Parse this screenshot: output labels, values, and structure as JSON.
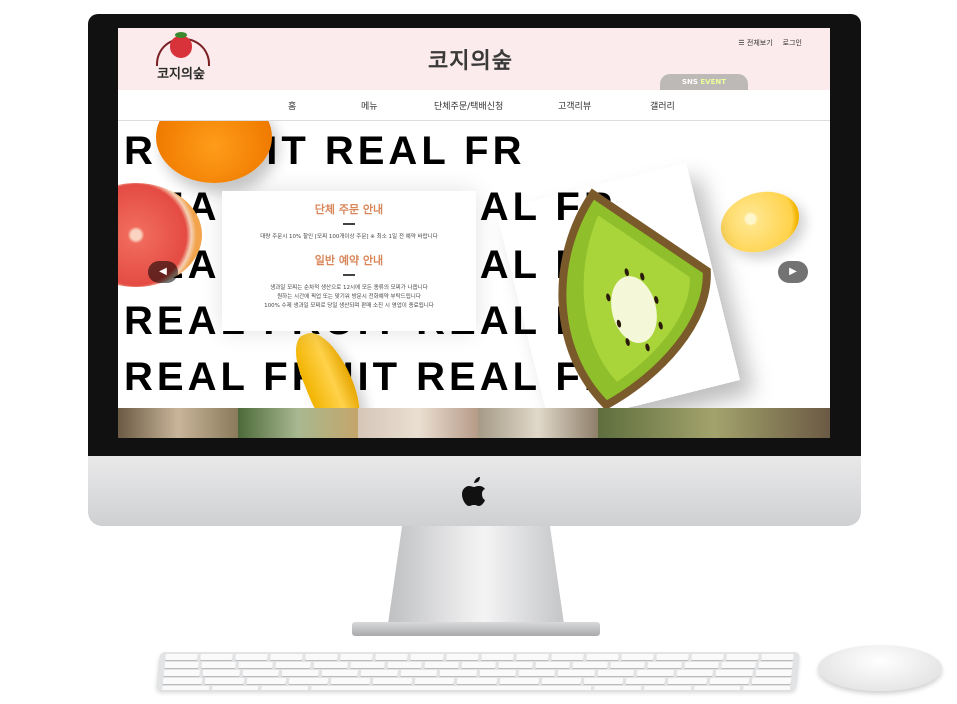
{
  "site": {
    "brand": "코지의숲",
    "logo_text": "코지의숲"
  },
  "header": {
    "util_links": [
      "전체보기",
      "로그인"
    ],
    "sns_event": {
      "prefix": "SNS",
      "accent": "EVENT"
    }
  },
  "nav": {
    "items": [
      "홈",
      "메뉴",
      "단체주문/택배신청",
      "고객리뷰",
      "갤러리"
    ]
  },
  "hero": {
    "marquee_lines": [
      "R    FRUIT REAL FR",
      "REAL FRUIT REAL FR",
      "REAL FRUIT REAL FR",
      "REAL FRUIT REAL FR",
      "REAL FRUIT REAL FR"
    ],
    "prev_label": "◀",
    "next_label": "▶"
  },
  "notice": {
    "group_title": "단체 주문 안내",
    "group_text": "대량 주문시 10% 할인 [모찌 100개이상 주문] ※ 최소 1일 전 예약 바랍니다",
    "reserve_title": "일반 예약 안내",
    "reserve_lines": [
      "생과일 모찌는 순차적 생산으로 12시에 모든 종류의 모찌가 나옵니다",
      "원하는 시간에 픽업 또는 맞기워 방문시 전화예약 부탁드립니다",
      "100% 수제 생과일 모찌로 당일 생산되며 판매 소진 시 영업이 종료됩니다"
    ]
  },
  "colors": {
    "header_bg": "#fcebec",
    "notice_accent": "#d9875a"
  },
  "icons": [
    "apple-logo-icon",
    "strawberry-logo-icon",
    "chevron-left-icon",
    "chevron-right-icon",
    "list-icon"
  ]
}
